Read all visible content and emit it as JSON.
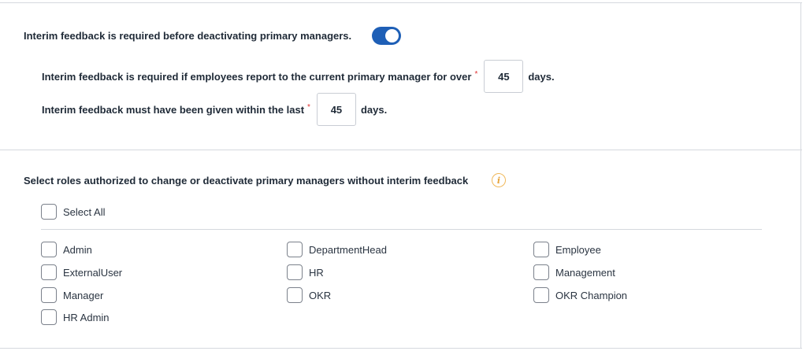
{
  "interim": {
    "title": "Interim feedback is required before deactivating primary managers.",
    "toggle_on": true,
    "over_days": {
      "label": "Interim feedback is required if employees report to the current primary manager for over",
      "required_mark": "*",
      "value": "45",
      "unit": "days."
    },
    "within_days": {
      "label": "Interim feedback must have been given within the last",
      "required_mark": "*",
      "value": "45",
      "unit": "days."
    }
  },
  "roles": {
    "title": "Select roles authorized to change or deactivate primary managers without interim feedback",
    "info_icon": "info-icon",
    "select_all": "Select All",
    "col1": [
      "Admin",
      "ExternalUser",
      "Manager",
      "HR Admin"
    ],
    "col2": [
      "DepartmentHead",
      "HR",
      "OKR"
    ],
    "col3": [
      "Employee",
      "Management",
      "OKR Champion"
    ]
  },
  "colors": {
    "toggle": "#1e5fb6",
    "required": "#e03131",
    "info": "#e7a43a",
    "border": "#d5d8de"
  }
}
